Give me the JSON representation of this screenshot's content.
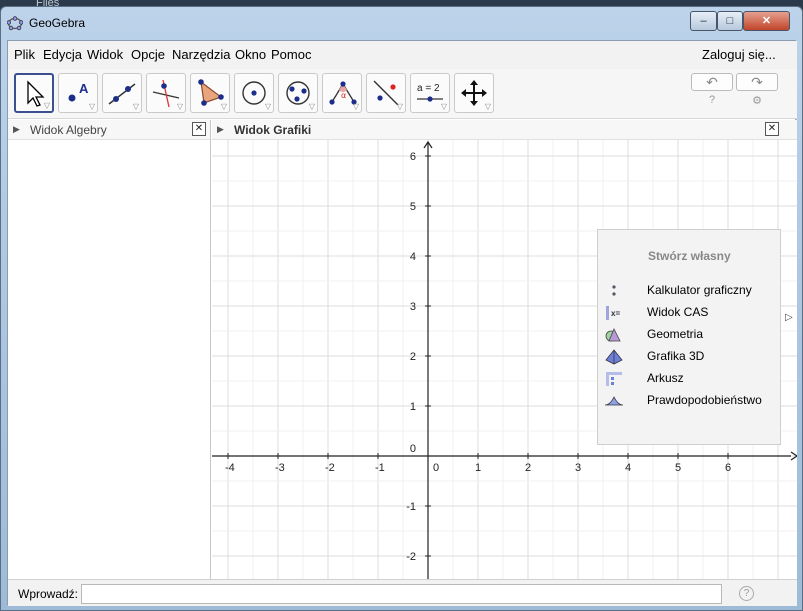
{
  "desktop": {
    "label": "Files"
  },
  "window": {
    "title": "GeoGebra",
    "controls": {
      "minimize": "–",
      "maximize": "□",
      "close": "✕"
    }
  },
  "menu": {
    "items": [
      "Plik",
      "Edycja",
      "Widok",
      "Opcje",
      "Narzędzia",
      "Okno",
      "Pomoc"
    ],
    "login": "Zaloguj się..."
  },
  "toolbar": {
    "tools": [
      "move",
      "point",
      "line",
      "perpendicular-line",
      "polygon",
      "circle",
      "conic",
      "angle",
      "reflect",
      "slider",
      "move-graphics"
    ],
    "slider_text": "a = 2",
    "undo_icon": "undo-icon",
    "redo_icon": "redo-icon",
    "help_icon": "?",
    "settings_icon": "⚙"
  },
  "algebra": {
    "title": "Widok Algebry"
  },
  "graphics": {
    "title": "Widok Grafiki",
    "axes": {
      "x_ticks": [
        "-4",
        "-3",
        "-2",
        "-1",
        "0",
        "1",
        "2",
        "3",
        "4",
        "5",
        "6"
      ],
      "y_ticks": [
        "6",
        "5",
        "4",
        "3",
        "2",
        "1",
        "0",
        "-1",
        "-2"
      ]
    }
  },
  "perspectives": {
    "title": "Stwórz własny",
    "items": [
      {
        "label": "Kalkulator graficzny",
        "icon": "graphing-calculator-icon"
      },
      {
        "label": "Widok CAS",
        "icon": "cas-icon"
      },
      {
        "label": "Geometria",
        "icon": "geometry-icon"
      },
      {
        "label": "Grafika 3D",
        "icon": "graphics-3d-icon"
      },
      {
        "label": "Arkusz",
        "icon": "spreadsheet-icon"
      },
      {
        "label": "Prawdopodobieństwo",
        "icon": "probability-icon"
      }
    ]
  },
  "input": {
    "label": "Wprowadź:",
    "value": "",
    "help": "?"
  }
}
